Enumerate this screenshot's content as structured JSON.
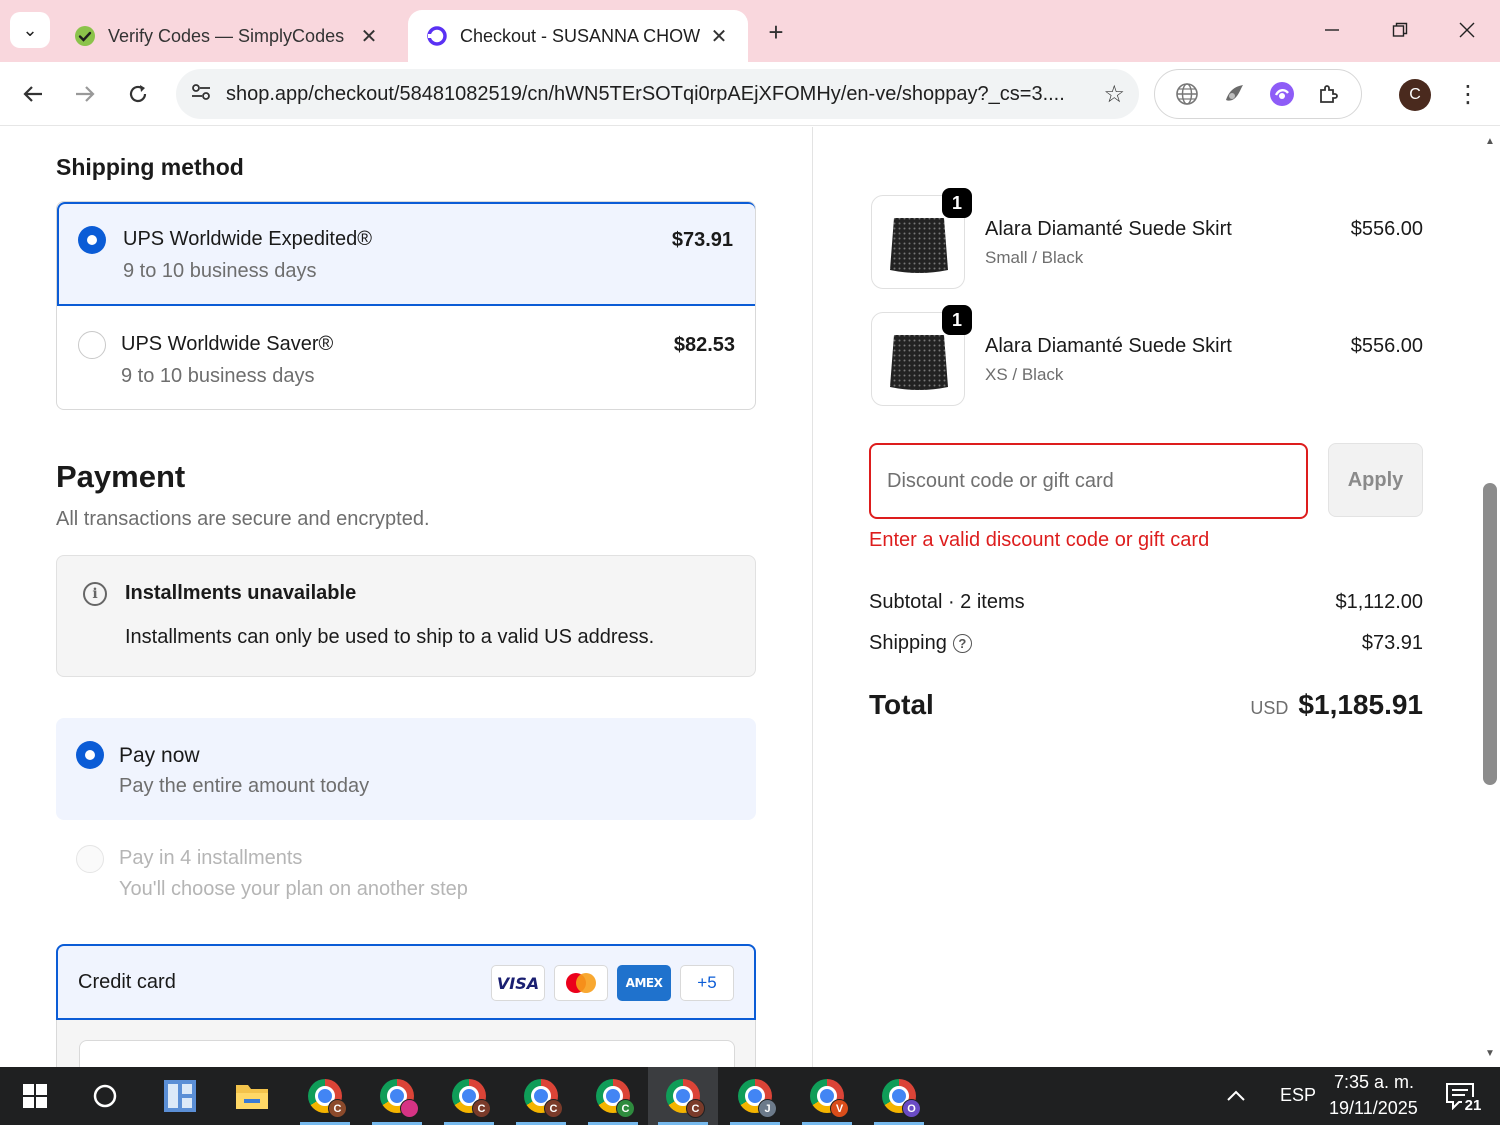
{
  "browser": {
    "tabs": [
      {
        "title": "Verify Codes — SimplyCodes",
        "active": false
      },
      {
        "title": "Checkout - SUSANNA CHOW",
        "active": true
      }
    ],
    "url": "shop.app/checkout/58481082519/cn/hWN5TErSOTqi0rpAEjXFOMHy/en-ve/shoppay?_cs=3....",
    "profile_initial": "C"
  },
  "shipping": {
    "title": "Shipping method",
    "options": [
      {
        "name": "UPS Worldwide Expedited®",
        "days": "9 to 10 business days",
        "price": "$73.91",
        "selected": true
      },
      {
        "name": "UPS Worldwide Saver®",
        "days": "9 to 10 business days",
        "price": "$82.53",
        "selected": false
      }
    ]
  },
  "payment": {
    "title": "Payment",
    "subtitle": "All transactions are secure and encrypted.",
    "installments_notice": {
      "title": "Installments unavailable",
      "body": "Installments can only be used to ship to a valid US address."
    },
    "options": [
      {
        "name": "Pay now",
        "sub": "Pay the entire amount today",
        "selected": true,
        "disabled": false
      },
      {
        "name": "Pay in 4 installments",
        "sub": "You'll choose your plan on another step",
        "selected": false,
        "disabled": true
      }
    ],
    "credit_card": {
      "label": "Credit card",
      "brands": [
        "VISA",
        "mastercard",
        "AMEX"
      ],
      "more": "+5"
    }
  },
  "order": {
    "items": [
      {
        "name": "Alara Diamanté Suede Skirt",
        "variant": "Small / Black",
        "price": "$556.00",
        "qty": "1"
      },
      {
        "name": "Alara Diamanté Suede Skirt",
        "variant": "XS / Black",
        "price": "$556.00",
        "qty": "1"
      }
    ],
    "discount_placeholder": "Discount code or gift card",
    "apply_label": "Apply",
    "discount_error": "Enter a valid discount code or gift card",
    "subtotal_label": "Subtotal · 2 items",
    "subtotal": "$1,112.00",
    "shipping_label": "Shipping",
    "shipping": "$73.91",
    "total_label": "Total",
    "currency": "USD",
    "total": "$1,185.91"
  },
  "taskbar": {
    "lang": "ESP",
    "time": "7:35 a. m.",
    "date": "19/11/2025",
    "notifications": "21",
    "chrome_profiles": [
      {
        "letter": "C",
        "color": "#8b4a2b"
      },
      {
        "letter": "",
        "color": "#d63384"
      },
      {
        "letter": "C",
        "color": "#7a3b2a"
      },
      {
        "letter": "C",
        "color": "#7a3b2a"
      },
      {
        "letter": "C",
        "color": "#2e8b3e"
      },
      {
        "letter": "C",
        "color": "#7a3b2a"
      },
      {
        "letter": "J",
        "color": "#6c7a8a"
      },
      {
        "letter": "V",
        "color": "#d94d1a"
      },
      {
        "letter": "O",
        "color": "#6a4bc4"
      }
    ]
  }
}
